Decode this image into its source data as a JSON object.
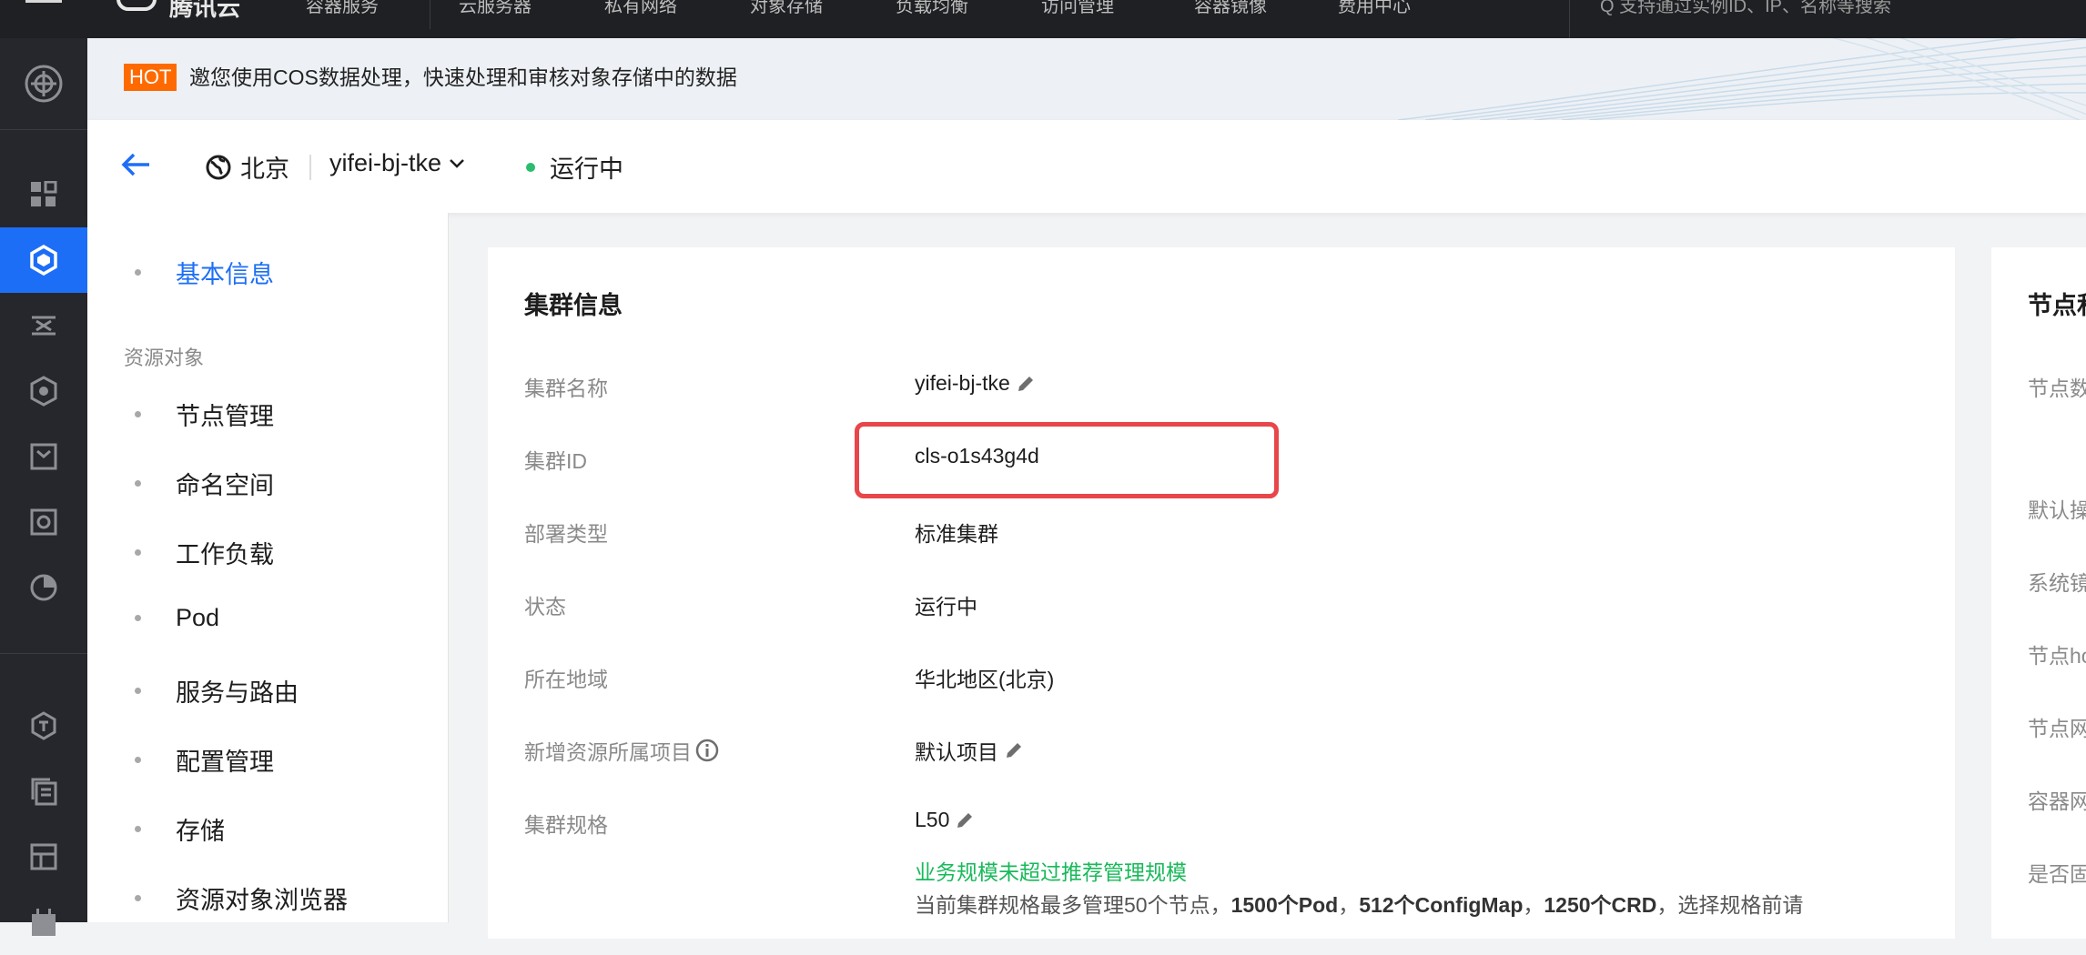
{
  "topbar": {
    "brand": "腾讯云",
    "nav": [
      "容器服务",
      "云服务器",
      "私有网络",
      "对象存储",
      "负载均衡",
      "访问管理",
      "容器镜像",
      "费用中心"
    ],
    "search_hint": "Q  支持通过实例ID、IP、名称等搜索"
  },
  "rail": {
    "icons": [
      "overview-icon",
      "grid-icon",
      "kubernetes-icon",
      "edge-icon",
      "cube-icon",
      "box-icon",
      "camera-icon",
      "pie-chart-icon",
      "shield-icon",
      "layers-icon",
      "store-icon",
      "calendar-icon"
    ]
  },
  "banner": {
    "hot": "HOT",
    "text": "邀您使用COS数据处理，快速处理和审核对象存储中的数据"
  },
  "header": {
    "region": "北京",
    "cluster": "yifei-bj-tke",
    "status": "运行中"
  },
  "leftnav": {
    "basic_info": "基本信息",
    "group_label": "资源对象",
    "items": [
      "节点管理",
      "命名空间",
      "工作负载",
      "Pod",
      "服务与路由",
      "配置管理",
      "存储",
      "资源对象浏览器"
    ]
  },
  "cluster_info": {
    "title": "集群信息",
    "rows": [
      {
        "label": "集群名称",
        "value": "yifei-bj-tke"
      },
      {
        "label": "集群ID",
        "value": "cls-o1s43g4d"
      },
      {
        "label": "部署类型",
        "value": "标准集群"
      },
      {
        "label": "状态",
        "value": "运行中"
      },
      {
        "label": "所在地域",
        "value": "华北地区(北京)"
      },
      {
        "label": "新增资源所属项目",
        "value": "默认项目"
      },
      {
        "label": "集群规格",
        "value": "L50"
      }
    ],
    "spec_ok": "业务规模未超过推荐管理规模",
    "spec_note_pre": "当前集群规格最多管理50个节点，",
    "spec_note_b1": "1500个Pod",
    "spec_note_m1": "，",
    "spec_note_b2": "512个ConfigMap",
    "spec_note_m2": "，",
    "spec_note_b3": "1250个CRD",
    "spec_note_post": "，选择规格前请"
  },
  "node_card": {
    "title": "节点和",
    "labels": [
      "节点数",
      "默认操",
      "系统镜",
      "节点ho",
      "节点网",
      "容器网",
      "是否固"
    ]
  },
  "colors": {
    "accent": "#1d6ef7",
    "highlight": "#e8464a",
    "success": "#18b95a",
    "hot": "#ff6a00"
  }
}
